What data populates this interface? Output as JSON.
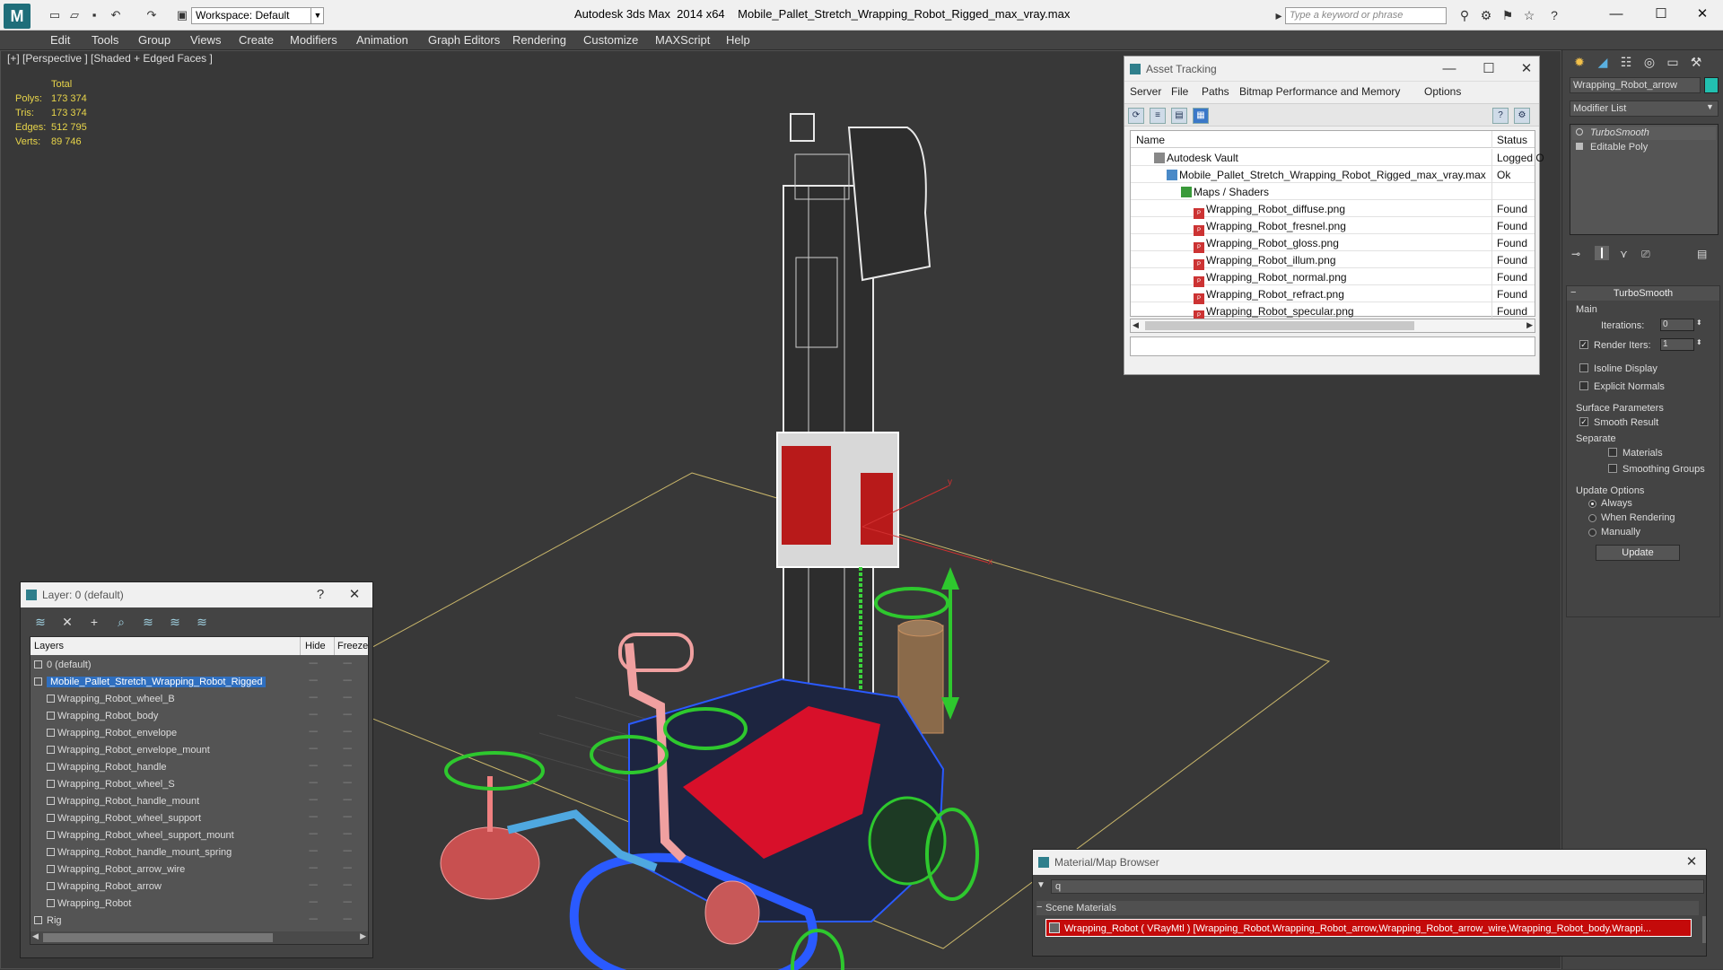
{
  "app": {
    "title": "Autodesk 3ds Max  2014 x64",
    "filename": "Mobile_Pallet_Stretch_Wrapping_Robot_Rigged_max_vray.max",
    "workspace": "Workspace: Default",
    "search_placeholder": "Type a keyword or phrase"
  },
  "menu": [
    "Edit",
    "Tools",
    "Group",
    "Views",
    "Create",
    "Modifiers",
    "Animation",
    "Graph Editors",
    "Rendering",
    "Customize",
    "MAXScript",
    "Help"
  ],
  "viewport": {
    "label": "[+] [Perspective ] [Shaded + Edged Faces ]",
    "stats": {
      "header": "Total",
      "rows": [
        {
          "label": "Polys:",
          "value": "173 374"
        },
        {
          "label": "Tris:",
          "value": "173 374"
        },
        {
          "label": "Edges:",
          "value": "512 795"
        },
        {
          "label": "Verts:",
          "value": "89 746"
        }
      ]
    },
    "axis": {
      "x": "x",
      "y": "y"
    }
  },
  "asset_tracking": {
    "title": "Asset Tracking",
    "menu": [
      "Server",
      "File",
      "Paths",
      "Bitmap Performance and Memory",
      "Options"
    ],
    "columns": {
      "name": "Name",
      "status": "Status"
    },
    "rows": [
      {
        "name": "Autodesk Vault",
        "status": "Logged O",
        "indent": 1,
        "icon": "vault"
      },
      {
        "name": "Mobile_Pallet_Stretch_Wrapping_Robot_Rigged_max_vray.max",
        "status": "Ok",
        "indent": 2,
        "icon": "max-file"
      },
      {
        "name": "Maps / Shaders",
        "status": "",
        "indent": 3,
        "icon": "maps"
      },
      {
        "name": "Wrapping_Robot_diffuse.png",
        "status": "Found",
        "indent": 4,
        "icon": "png"
      },
      {
        "name": "Wrapping_Robot_fresnel.png",
        "status": "Found",
        "indent": 4,
        "icon": "png"
      },
      {
        "name": "Wrapping_Robot_gloss.png",
        "status": "Found",
        "indent": 4,
        "icon": "png"
      },
      {
        "name": "Wrapping_Robot_illum.png",
        "status": "Found",
        "indent": 4,
        "icon": "png"
      },
      {
        "name": "Wrapping_Robot_normal.png",
        "status": "Found",
        "indent": 4,
        "icon": "png"
      },
      {
        "name": "Wrapping_Robot_refract.png",
        "status": "Found",
        "indent": 4,
        "icon": "png"
      },
      {
        "name": "Wrapping_Robot_specular.png",
        "status": "Found",
        "indent": 4,
        "icon": "png"
      }
    ]
  },
  "layers": {
    "title": "Layer: 0 (default)",
    "columns": {
      "layers": "Layers",
      "hide": "Hide",
      "freeze": "Freeze"
    },
    "rows": [
      {
        "name": "0 (default)",
        "level": 0,
        "selected": false
      },
      {
        "name": "Mobile_Pallet_Stretch_Wrapping_Robot_Rigged",
        "level": 0,
        "selected": true
      },
      {
        "name": "Wrapping_Robot_wheel_B",
        "level": 1,
        "selected": false
      },
      {
        "name": "Wrapping_Robot_body",
        "level": 1,
        "selected": false
      },
      {
        "name": "Wrapping_Robot_envelope",
        "level": 1,
        "selected": false
      },
      {
        "name": "Wrapping_Robot_envelope_mount",
        "level": 1,
        "selected": false
      },
      {
        "name": "Wrapping_Robot_handle",
        "level": 1,
        "selected": false
      },
      {
        "name": "Wrapping_Robot_wheel_S",
        "level": 1,
        "selected": false
      },
      {
        "name": "Wrapping_Robot_handle_mount",
        "level": 1,
        "selected": false
      },
      {
        "name": "Wrapping_Robot_wheel_support",
        "level": 1,
        "selected": false
      },
      {
        "name": "Wrapping_Robot_wheel_support_mount",
        "level": 1,
        "selected": false
      },
      {
        "name": "Wrapping_Robot_handle_mount_spring",
        "level": 1,
        "selected": false
      },
      {
        "name": "Wrapping_Robot_arrow_wire",
        "level": 1,
        "selected": false
      },
      {
        "name": "Wrapping_Robot_arrow",
        "level": 1,
        "selected": false
      },
      {
        "name": "Wrapping_Robot",
        "level": 1,
        "selected": false
      },
      {
        "name": "Rig",
        "level": 0,
        "selected": false
      }
    ]
  },
  "command_panel": {
    "object_name": "Wrapping_Robot_arrow",
    "object_color": "#22c0b0",
    "modifier_list": "Modifier List",
    "stack": [
      "TurboSmooth",
      "Editable Poly"
    ],
    "turbosmooth": {
      "title": "TurboSmooth",
      "main": "Main",
      "iterations_label": "Iterations:",
      "iterations_value": "0",
      "render_iters_label": "Render Iters:",
      "render_iters_value": "1",
      "isoline": "Isoline Display",
      "explicit_normals": "Explicit Normals",
      "surface_params": "Surface Parameters",
      "smooth_result": "Smooth Result",
      "separate": "Separate",
      "materials": "Materials",
      "smoothing_groups": "Smoothing Groups",
      "update_options": "Update Options",
      "always": "Always",
      "when_rendering": "When Rendering",
      "manually": "Manually",
      "update_btn": "Update"
    }
  },
  "material_browser": {
    "title": "Material/Map Browser",
    "search": "q",
    "group": "Scene Materials",
    "item": "Wrapping_Robot ( VRayMtl ) [Wrapping_Robot,Wrapping_Robot_arrow,Wrapping_Robot_arrow_wire,Wrapping_Robot_body,Wrappi..."
  }
}
